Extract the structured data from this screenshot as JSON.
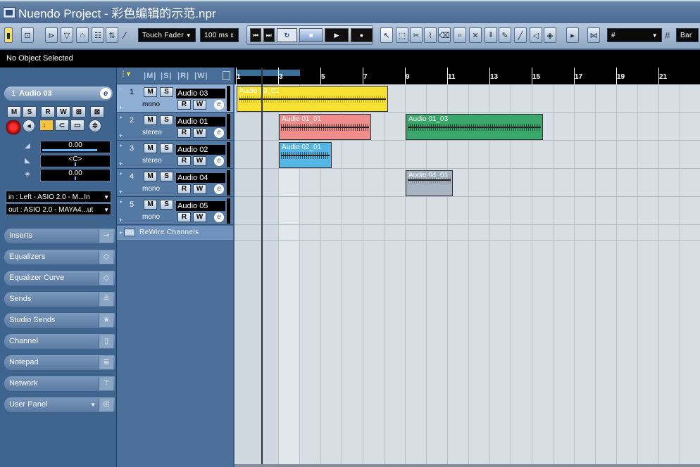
{
  "window": {
    "title": "Nuendo Project - 彩色编辑的示范.npr"
  },
  "toolbar": {
    "automation_mode": "Touch Fader",
    "automation_time": "100 ms",
    "quantize": "Bar"
  },
  "infoline": {
    "text": "No Object Selected"
  },
  "inspector": {
    "track_number": "1",
    "track_name": "Audio 03",
    "volume": "0.00",
    "pan": "<C>",
    "delay": "0.00",
    "in_routing": "in : Left - ASIO 2.0 - M...In",
    "out_routing": "out : ASIO 2.0 - MAYA4...ut",
    "sections": [
      "Inserts",
      "Equalizers",
      "Equalizer Curve",
      "Sends",
      "Studio Sends",
      "Channel",
      "Notepad",
      "Network",
      "User Panel"
    ]
  },
  "tracklist": {
    "tracks": [
      {
        "num": "1",
        "name": "Audio 03",
        "type": "mono"
      },
      {
        "num": "2",
        "name": "Audio 01",
        "type": "stereo"
      },
      {
        "num": "3",
        "name": "Audio 02",
        "type": "stereo"
      },
      {
        "num": "4",
        "name": "Audio 04",
        "type": "mono"
      },
      {
        "num": "5",
        "name": "Audio 05",
        "type": "mono"
      }
    ],
    "rewire_label": "ReWire Channels",
    "btn_m": "M",
    "btn_s": "S",
    "btn_r": "R",
    "btn_w": "W",
    "btn_e": "e"
  },
  "ruler": {
    "marks": [
      "1",
      "3",
      "5",
      "7",
      "9",
      "11",
      "13",
      "15",
      "17",
      "19",
      "21"
    ]
  },
  "events": [
    {
      "name": "Audio 03_01",
      "color": "#f7e132"
    },
    {
      "name": "Audio 01_01",
      "color": "#ef8c8c"
    },
    {
      "name": "Audio 01_03",
      "color": "#3aa86a"
    },
    {
      "name": "Audio 02_01",
      "color": "#55b6e6"
    },
    {
      "name": "Audio 04_01",
      "color": "#a6b4c2"
    }
  ]
}
